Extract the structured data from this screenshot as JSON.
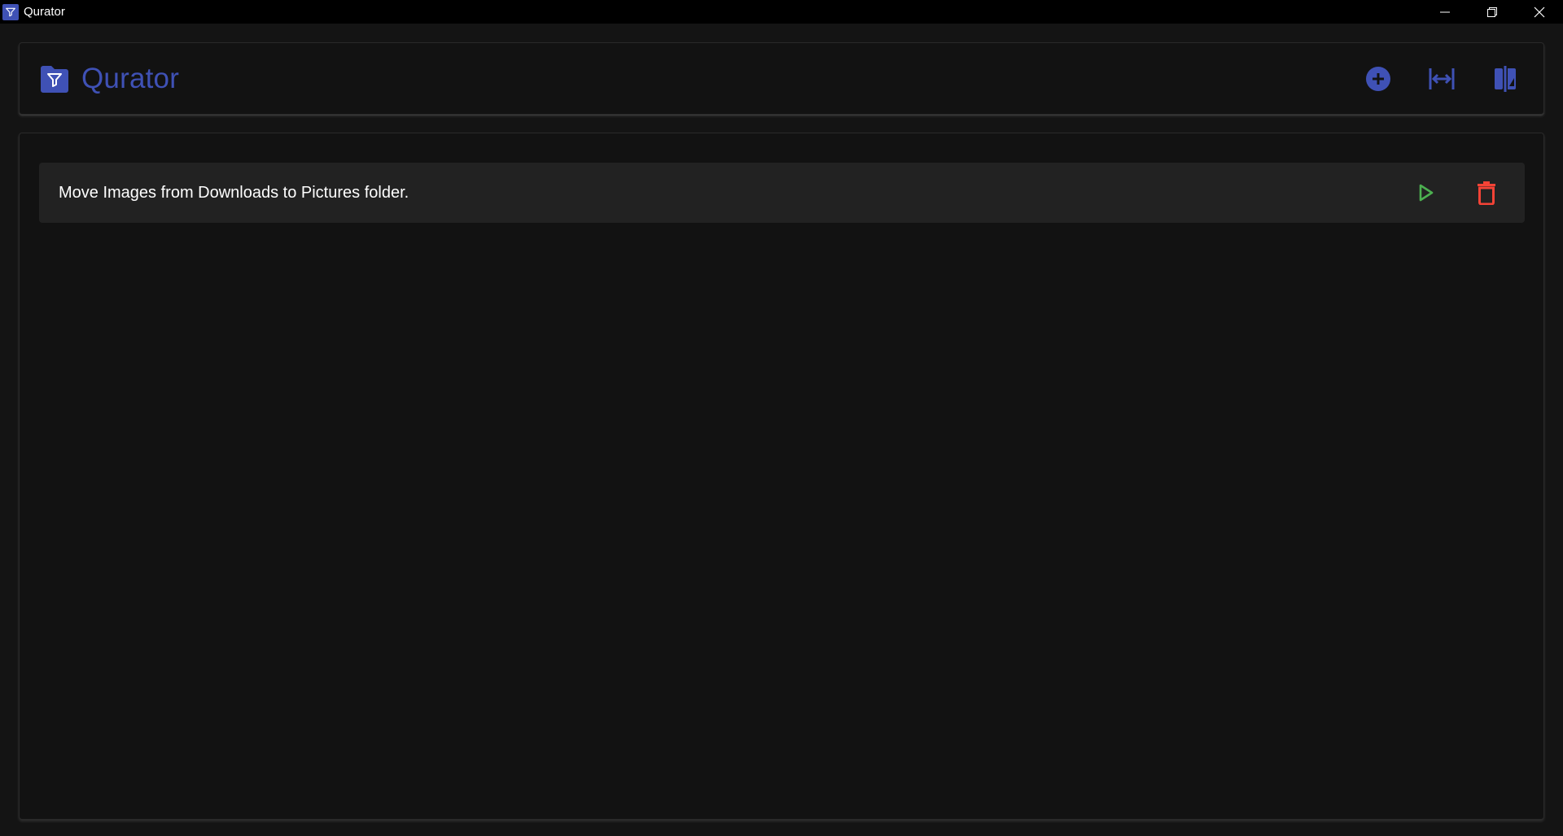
{
  "window": {
    "title": "Qurator",
    "controls": [
      "minimize-icon",
      "restore-icon",
      "close-icon"
    ]
  },
  "header": {
    "brand_title": "Qurator",
    "brand_icon": "folder-filter-icon",
    "actions": [
      {
        "icon": "add-circle-icon"
      },
      {
        "icon": "fit-width-icon"
      },
      {
        "icon": "compare-icon"
      }
    ]
  },
  "tasks": [
    {
      "label": "Move Images from Downloads to Pictures folder.",
      "actions": [
        {
          "icon": "play-icon"
        },
        {
          "icon": "trash-icon"
        }
      ]
    }
  ],
  "colors": {
    "accent": "#3f51b5",
    "play": "#4caf50",
    "delete": "#f44336",
    "background": "#141414",
    "card": "#121212",
    "row": "#222222"
  }
}
